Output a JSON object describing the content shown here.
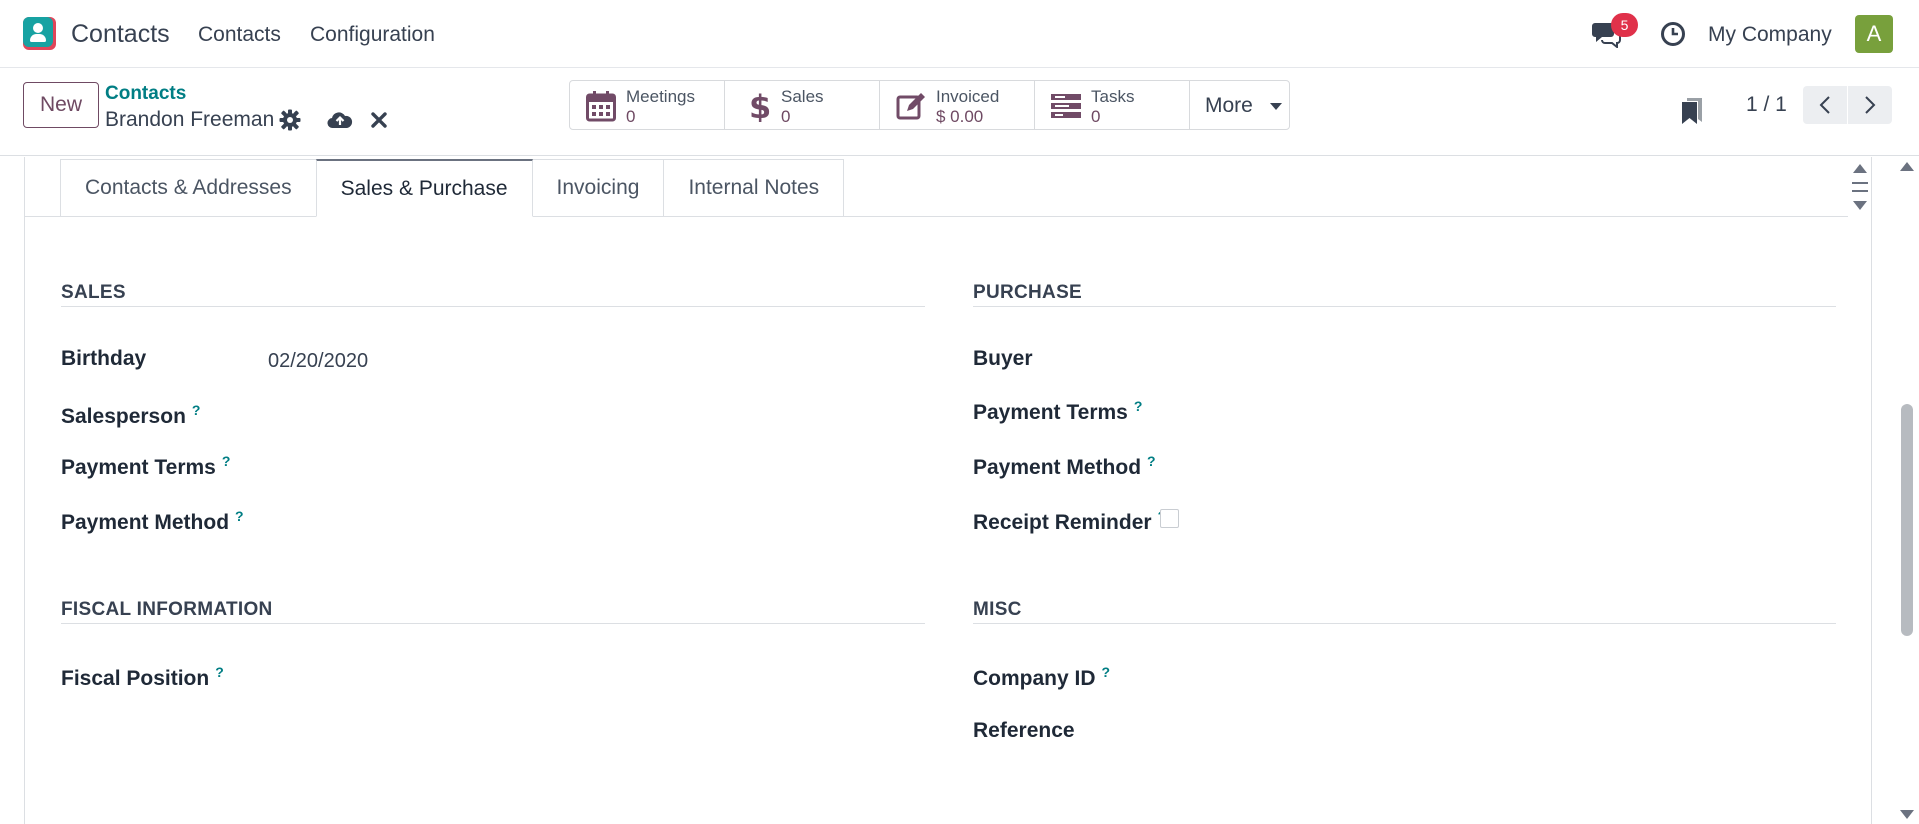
{
  "app": {
    "name": "Contacts"
  },
  "nav": {
    "contacts": "Contacts",
    "configuration": "Configuration"
  },
  "systray": {
    "message_count": "5",
    "company": "My Company",
    "avatar_letter": "A"
  },
  "control": {
    "new_label": "New",
    "breadcrumb_parent": "Contacts",
    "record_name": "Brandon Freeman",
    "stats": [
      {
        "label": "Meetings",
        "value": "0",
        "icon": "calendar-icon"
      },
      {
        "label": "Sales",
        "value": "0",
        "icon": "dollar-icon"
      },
      {
        "label": "Invoiced",
        "value": "$ 0.00",
        "icon": "edit-icon"
      },
      {
        "label": "Tasks",
        "value": "0",
        "icon": "tasks-icon"
      }
    ],
    "more_label": "More",
    "pager": "1 / 1"
  },
  "tabs": {
    "contacts_addresses": "Contacts & Addresses",
    "sales_purchase": "Sales & Purchase",
    "invoicing": "Invoicing",
    "internal_notes": "Internal Notes",
    "active": "Sales & Purchase"
  },
  "sales": {
    "title": "SALES",
    "birthday_label": "Birthday",
    "birthday_value": "02/20/2020",
    "salesperson_label": "Salesperson",
    "payment_terms_label": "Payment Terms",
    "payment_method_label": "Payment Method"
  },
  "purchase": {
    "title": "PURCHASE",
    "buyer_label": "Buyer",
    "payment_terms_label": "Payment Terms",
    "payment_method_label": "Payment Method",
    "receipt_reminder_label": "Receipt Reminder"
  },
  "fiscal": {
    "title": "FISCAL INFORMATION",
    "fiscal_position_label": "Fiscal Position"
  },
  "misc": {
    "title": "MISC",
    "company_id_label": "Company ID",
    "reference_label": "Reference"
  },
  "help_mark": "?",
  "colors": {
    "brand": "#6f4a63",
    "link": "#017e84",
    "badge": "#e0314a",
    "avatar": "#78a03c"
  }
}
